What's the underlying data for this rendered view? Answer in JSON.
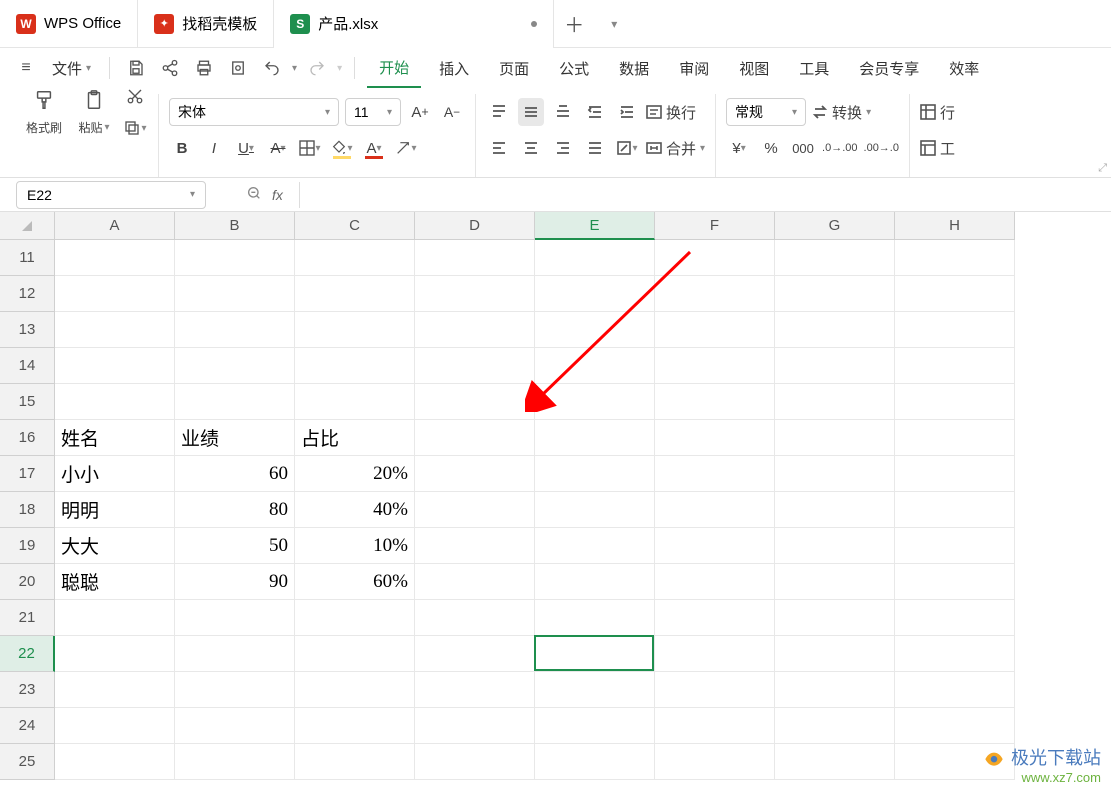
{
  "titlebar": {
    "wps_label": "WPS Office",
    "docer_label": "找稻壳模板",
    "doc_label": "产品.xlsx"
  },
  "menu": {
    "hamburger": "≡",
    "file": "文件",
    "tabs": [
      "开始",
      "插入",
      "页面",
      "公式",
      "数据",
      "审阅",
      "视图",
      "工具",
      "会员专享",
      "效率"
    ],
    "active_index": 0
  },
  "ribbon": {
    "format_painter": "格式刷",
    "paste": "粘贴",
    "font_name": "宋体",
    "font_size": "11",
    "wrap": "换行",
    "merge": "合并",
    "num_format": "常规",
    "convert": "转换",
    "row_col": "行",
    "worksheet": "工"
  },
  "formula": {
    "name_box": "E22",
    "fx": "fx"
  },
  "grid": {
    "columns": [
      "A",
      "B",
      "C",
      "D",
      "E",
      "F",
      "G",
      "H"
    ],
    "rows": [
      "11",
      "12",
      "13",
      "14",
      "15",
      "16",
      "17",
      "18",
      "19",
      "20",
      "21",
      "22",
      "23",
      "24",
      "25"
    ],
    "selected_col": "E",
    "selected_row": "22",
    "data": {
      "16": {
        "A": "姓名",
        "B": "业绩",
        "C": "占比"
      },
      "17": {
        "A": "小小",
        "B": "60",
        "C": "20%"
      },
      "18": {
        "A": "明明",
        "B": "80",
        "C": "40%"
      },
      "19": {
        "A": "大大",
        "B": "50",
        "C": "10%"
      },
      "20": {
        "A": "聪聪",
        "B": "90",
        "C": "60%"
      }
    }
  },
  "watermark": {
    "title": "极光下载站",
    "url": "www.xz7.com"
  }
}
